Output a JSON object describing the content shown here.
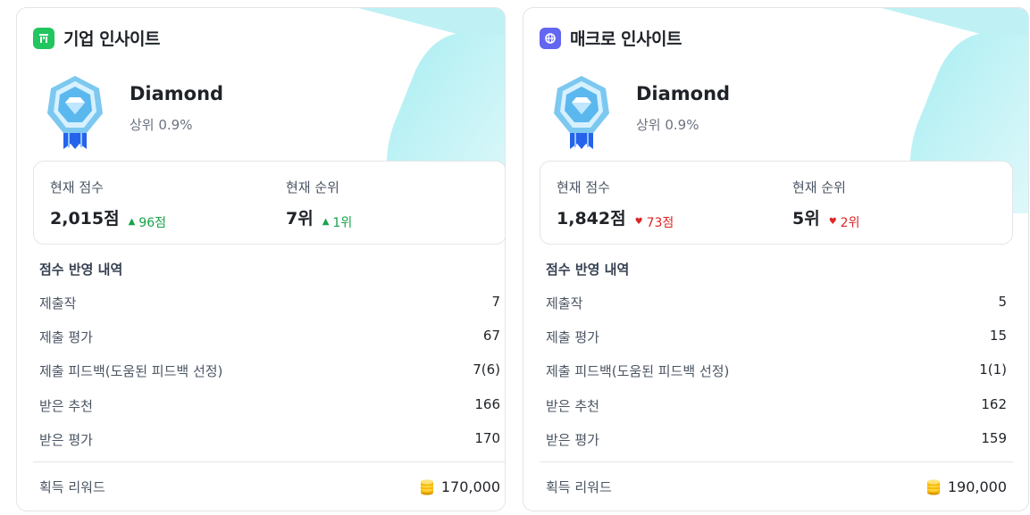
{
  "cards": [
    {
      "title": "기업 인사이트",
      "icon": "building-icon",
      "icon_color": "#22c55e",
      "tier": "Diamond",
      "rank_text": "상위 0.9%",
      "score_label": "현재 점수",
      "score_value": "2,015점",
      "score_delta": "96점",
      "score_delta_dir": "up",
      "position_label": "현재 순위",
      "position_value": "7위",
      "position_delta": "1위",
      "position_delta_dir": "up",
      "history_title": "점수 반영 내역",
      "history": [
        {
          "label": "제출작",
          "value": "7"
        },
        {
          "label": "제출 평가",
          "value": "67"
        },
        {
          "label": "제출 피드백(도움된 피드백 선정)",
          "value": "7(6)"
        },
        {
          "label": "받은 추천",
          "value": "166"
        },
        {
          "label": "받은 평가",
          "value": "170"
        }
      ],
      "reward_label": "획득 리워드",
      "reward_value": "170,000"
    },
    {
      "title": "매크로 인사이트",
      "icon": "globe-icon",
      "icon_color": "#6366f1",
      "tier": "Diamond",
      "rank_text": "상위 0.9%",
      "score_label": "현재 점수",
      "score_value": "1,842점",
      "score_delta": "73점",
      "score_delta_dir": "down",
      "position_label": "현재 순위",
      "position_value": "5위",
      "position_delta": "2위",
      "position_delta_dir": "down",
      "history_title": "점수 반영 내역",
      "history": [
        {
          "label": "제출작",
          "value": "5"
        },
        {
          "label": "제출 평가",
          "value": "15"
        },
        {
          "label": "제출 피드백(도움된 피드백 선정)",
          "value": "1(1)"
        },
        {
          "label": "받은 추천",
          "value": "162"
        },
        {
          "label": "받은 평가",
          "value": "159"
        }
      ],
      "reward_label": "획득 리워드",
      "reward_value": "190,000"
    }
  ],
  "colors": {
    "up": "#16a34a",
    "down": "#dc2626",
    "deco": "#7fdfe6",
    "coin": "#f5b800"
  }
}
